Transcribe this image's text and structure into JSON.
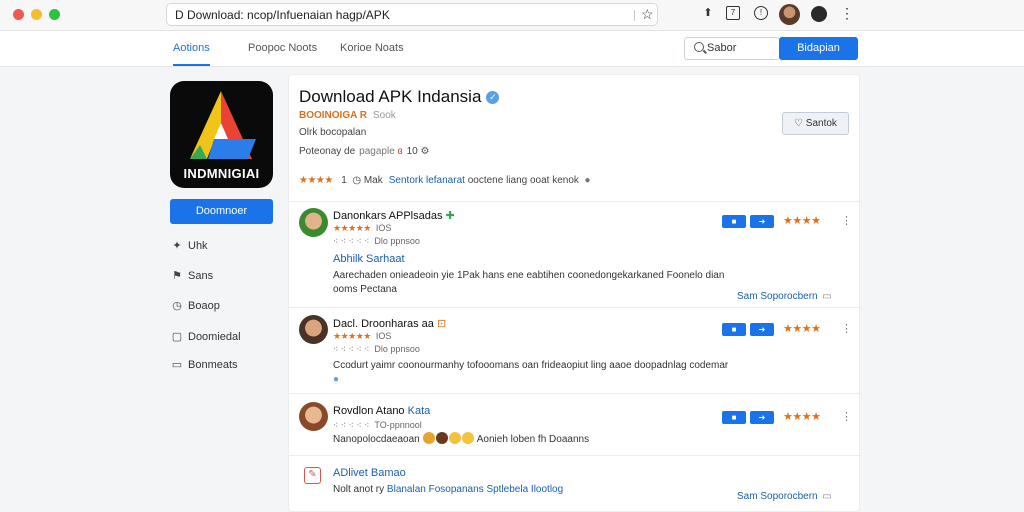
{
  "browser": {
    "url": "D Download: ncop/Infuenaian hagp/APK",
    "colors": {
      "close": "#ee5a52",
      "minimize": "#f5be2f",
      "maximize": "#2cc340"
    }
  },
  "nav": {
    "tabs": [
      "Aotions",
      "Poopoc Noots",
      "Korioe Noats"
    ],
    "search_value": "Sabor",
    "button_label": "Bidapian"
  },
  "sidebar": {
    "brand_text": "INDMNIGIAI",
    "button_label": "Doomnoer",
    "items": [
      {
        "icon": "sparkle-icon",
        "label": "Uhk"
      },
      {
        "icon": "bookmark-icon",
        "label": "Sans"
      },
      {
        "icon": "clock-icon",
        "label": "Boaop"
      },
      {
        "icon": "download-icon",
        "label": "Doomiedal"
      },
      {
        "icon": "comment-icon",
        "label": "Bonmeats"
      }
    ]
  },
  "app": {
    "title": "Download APK Indansia",
    "subtitle": "BOOINOIGA R",
    "subtitle_extra": "Sook",
    "line2": "Olrk bocopalan",
    "line3_label": "Poteonay de",
    "line3_faded": "pagaple",
    "line3_value": "10",
    "rating_stars": "★★★★",
    "rating_count": "1",
    "rating_meta": "Mak",
    "rating_link": "Sentork lefanarat",
    "rating_tail": "ooctene liang ooat kenok",
    "save_label": "Santok"
  },
  "reviews": [
    {
      "name": "Danonkars APPlsadas",
      "stars": "★★★★★",
      "meta1": "IOS",
      "meta2": "Dlo ppnsoo",
      "label": "Abhilk Sarhaat",
      "text": "Aarechaden onieadeoin yie 1Pak hans ene eabtihen coonedongekarkaned Foonelo dian ooms Pectana",
      "link": "Sam Soporocbern",
      "rating": "★★★★"
    },
    {
      "name": "Dacl. Droonharas aa",
      "stars": "★★★★★",
      "meta1": "IOS",
      "meta2": "Dlo ppnsoo",
      "text": "Ccodurt yaimr coonourmanhy tofooomans oan frideaopiut ling aaoe doopadnlag codemar",
      "rating": "★★★★"
    },
    {
      "name": "Rovdlon Atano",
      "name_link": "Kata",
      "meta2": "TO-ppnnool",
      "text_before": "Nanopolocdaeaoan",
      "text_after": "Aonieh loben fh Doaanns",
      "rating": "★★★★"
    },
    {
      "label": "ADlivet Bamao",
      "text_before": "Nolt anot ry",
      "text_link": "Blanalan Fosopanans Sptlebela Ilootlog",
      "link": "Sam Soporocbern"
    }
  ]
}
